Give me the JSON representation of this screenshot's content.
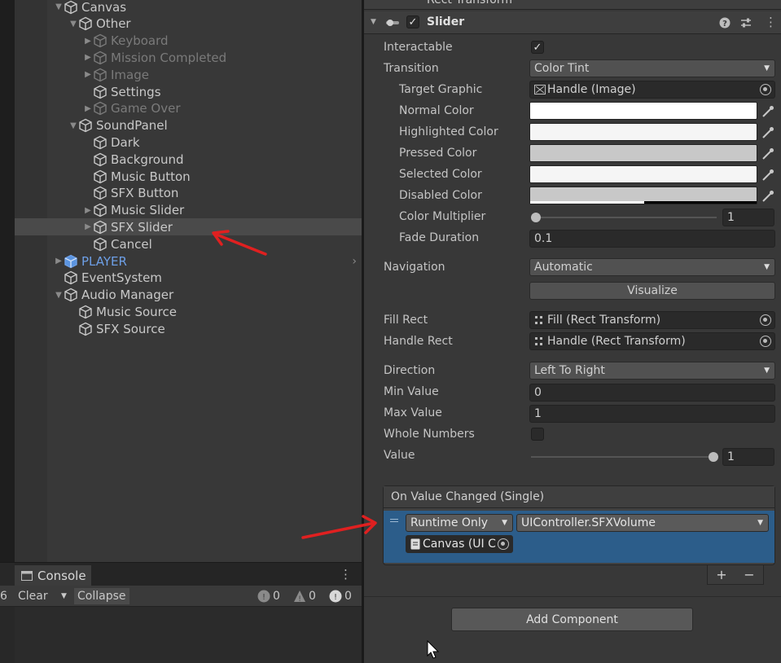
{
  "hierarchy": {
    "items": [
      {
        "label": "Canvas",
        "expanded": true,
        "depth": 1,
        "state": "normal"
      },
      {
        "label": "Other",
        "expanded": true,
        "depth": 2,
        "state": "normal"
      },
      {
        "label": "Keyboard",
        "collapsed": true,
        "depth": 3,
        "state": "dim"
      },
      {
        "label": "Mission Completed",
        "collapsed": true,
        "depth": 3,
        "state": "dim"
      },
      {
        "label": "Image",
        "collapsed": true,
        "depth": 3,
        "state": "dim"
      },
      {
        "label": "Settings",
        "depth": 3,
        "state": "normal"
      },
      {
        "label": "Game Over",
        "collapsed": true,
        "depth": 3,
        "state": "dim"
      },
      {
        "label": "SoundPanel",
        "expanded": true,
        "depth": 2,
        "state": "normal"
      },
      {
        "label": "Dark",
        "depth": 3,
        "state": "normal"
      },
      {
        "label": "Background",
        "depth": 3,
        "state": "normal"
      },
      {
        "label": "Music Button",
        "depth": 3,
        "state": "normal"
      },
      {
        "label": "SFX Button",
        "depth": 3,
        "state": "normal"
      },
      {
        "label": "Music Slider",
        "collapsed": true,
        "depth": 3,
        "state": "normal"
      },
      {
        "label": "SFX Slider",
        "collapsed": true,
        "depth": 3,
        "state": "selected"
      },
      {
        "label": "Cancel",
        "depth": 3,
        "state": "normal"
      },
      {
        "label": "PLAYER",
        "collapsed": true,
        "depth": 1,
        "state": "prefab"
      },
      {
        "label": "EventSystem",
        "depth": 1,
        "state": "normal"
      },
      {
        "label": "Audio Manager",
        "expanded": true,
        "depth": 1,
        "state": "normal"
      },
      {
        "label": "Music Source",
        "depth": 2,
        "state": "normal"
      },
      {
        "label": "SFX Source",
        "depth": 2,
        "state": "normal"
      }
    ]
  },
  "console": {
    "tab_label": "Console",
    "clear_label": "Clear",
    "collapse_label": "Collapse",
    "left_number": "6",
    "log_count": "0",
    "warning_count": "0",
    "error_count": "0"
  },
  "inspector": {
    "rect_transform_title": "Rect Transform",
    "component_title": "Slider",
    "interactable_label": "Interactable",
    "transition_label": "Transition",
    "transition_value": "Color Tint",
    "target_graphic_label": "Target Graphic",
    "target_graphic_value": "Handle (Image)",
    "normal_color_label": "Normal Color",
    "highlighted_color_label": "Highlighted Color",
    "pressed_color_label": "Pressed Color",
    "selected_color_label": "Selected Color",
    "disabled_color_label": "Disabled Color",
    "color_multiplier_label": "Color Multiplier",
    "color_multiplier_value": "1",
    "fade_duration_label": "Fade Duration",
    "fade_duration_value": "0.1",
    "navigation_label": "Navigation",
    "navigation_value": "Automatic",
    "visualize_label": "Visualize",
    "fill_rect_label": "Fill Rect",
    "fill_rect_value": "Fill (Rect Transform)",
    "handle_rect_label": "Handle Rect",
    "handle_rect_value": "Handle (Rect Transform)",
    "direction_label": "Direction",
    "direction_value": "Left To Right",
    "min_value_label": "Min Value",
    "min_value": "0",
    "max_value_label": "Max Value",
    "max_value": "1",
    "whole_numbers_label": "Whole Numbers",
    "value_label": "Value",
    "value": "1",
    "event_title": "On Value Changed (Single)",
    "runtime_label": "Runtime Only",
    "function_label": "UIController.SFXVolume",
    "object_label": "Canvas (UI C",
    "plus_label": "+",
    "minus_label": "−",
    "add_component_label": "Add Component"
  },
  "colors": {
    "normal": "#ffffff",
    "highlighted": "#f5f5f5",
    "pressed": "#c8c8c8",
    "selected": "#f5f5f5",
    "disabled": "#c8c8c8",
    "event_row": "#2c5d8a",
    "prefab_text": "#6d9fe6",
    "annotation_arrow": "#e02020"
  }
}
